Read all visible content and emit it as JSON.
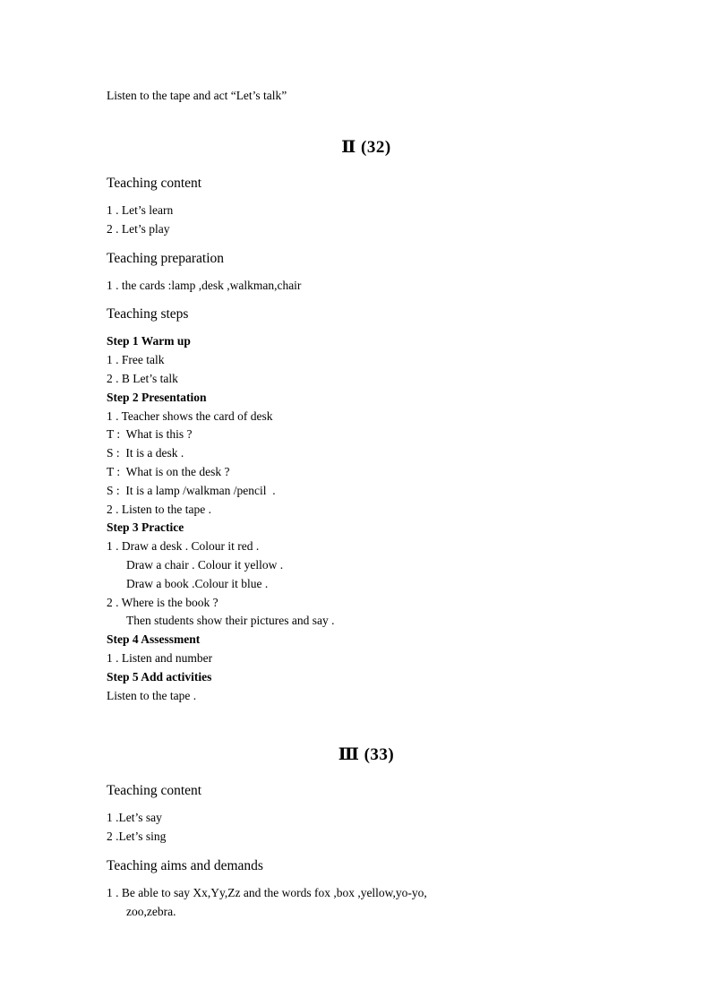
{
  "document": {
    "intro_line": "Listen to the tape and act “Let’s talk”",
    "sections": [
      {
        "title": "Ⅱ (32)",
        "headings": {
          "content": "Teaching content",
          "preparation": "Teaching preparation",
          "steps": "Teaching steps"
        },
        "content_items": [
          "1 . Let’s learn",
          "2 . Let’s play"
        ],
        "preparation_items": [
          "1 . the cards :lamp ,desk ,walkman,chair"
        ],
        "steps": [
          {
            "label": "Step 1 Warm up",
            "lines": [
              {
                "text": "1 . Free talk",
                "indent": false
              },
              {
                "text": "2 . B Let’s talk",
                "indent": false
              }
            ]
          },
          {
            "label": "Step 2 Presentation",
            "lines": [
              {
                "text": "1 . Teacher shows the card of desk",
                "indent": false
              },
              {
                "text": "T :  What is this ?",
                "indent": false
              },
              {
                "text": "S :  It is a desk .",
                "indent": false
              },
              {
                "text": "T :  What is on the desk ?",
                "indent": false
              },
              {
                "text": "S :  It is a lamp /walkman /pencil  .",
                "indent": false
              },
              {
                "text": "2 . Listen to the tape .",
                "indent": false
              }
            ]
          },
          {
            "label": "Step 3 Practice",
            "lines": [
              {
                "text": "1 . Draw a desk . Colour it red .",
                "indent": false
              },
              {
                "text": "Draw a chair . Colour it yellow .",
                "indent": true
              },
              {
                "text": "Draw a book .Colour it blue .",
                "indent": true
              },
              {
                "text": "2 . Where is the book ?",
                "indent": false
              },
              {
                "text": "Then students show their pictures and say .",
                "indent": true
              }
            ]
          },
          {
            "label": "Step 4 Assessment",
            "lines": [
              {
                "text": "1 . Listen and number",
                "indent": false
              }
            ]
          },
          {
            "label": "Step 5 Add activities",
            "lines": [
              {
                "text": "Listen to the tape .",
                "indent": false
              }
            ]
          }
        ]
      },
      {
        "title": "Ⅲ (33)",
        "headings": {
          "content": "Teaching content",
          "aims": "Teaching aims and demands"
        },
        "content_items": [
          "1 .Let’s say",
          "2 .Let’s sing"
        ],
        "aims_lines": [
          {
            "text": "1 . Be able to say Xx,Yy,Zz and the words fox ,box ,yellow,yo-yo,",
            "indent": false
          },
          {
            "text": "zoo,zebra.",
            "indent": true
          }
        ]
      }
    ]
  }
}
